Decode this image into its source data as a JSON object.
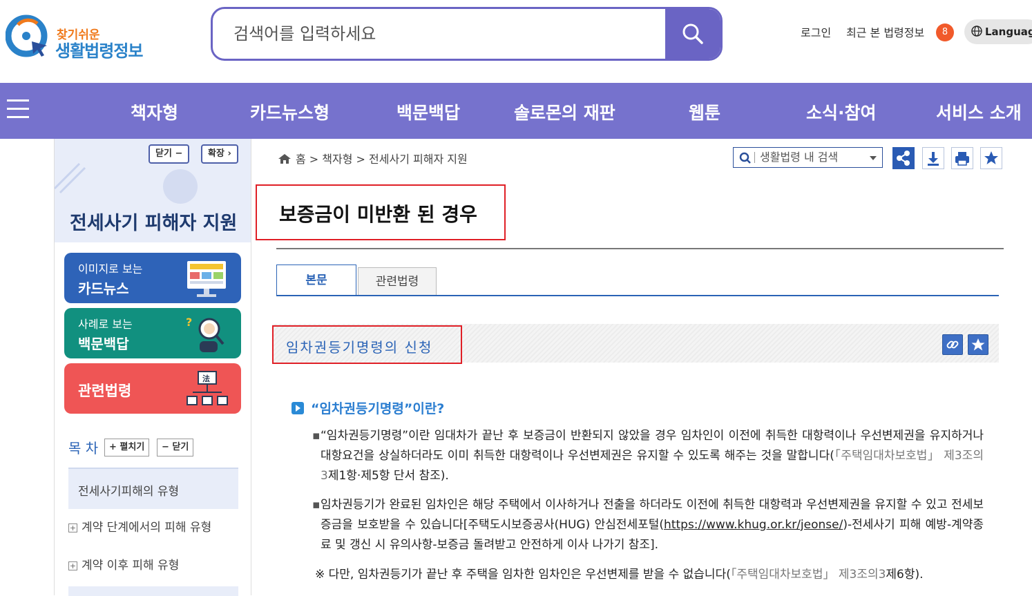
{
  "header": {
    "logo_small": "찾기쉬운",
    "logo_big": "생활법령정보",
    "search_placeholder": "검색어를 입력하세요",
    "login": "로그인",
    "recent": "최근 본 법령정보",
    "recent_count": "8",
    "language": "Language"
  },
  "nav": {
    "items": [
      "책자형",
      "카드뉴스형",
      "백문백답",
      "솔로몬의 재판",
      "웹툰",
      "소식·참여",
      "서비스 소개"
    ]
  },
  "sidebar": {
    "close_label": "닫기 −",
    "expand_label": "확장 ›",
    "title": "전세사기 피해자 지원",
    "cards": [
      {
        "small": "이미지로 보는",
        "big": "카드뉴스",
        "color": "#2e63b8"
      },
      {
        "small": "사례로 보는",
        "big": "백문백답",
        "color": "#11907f"
      },
      {
        "big": "관련법령",
        "color": "#ef5555"
      }
    ],
    "toc_label": "목 차",
    "toc_expand": "+ 펼치기",
    "toc_collapse": "− 닫기",
    "toc_selected": "전세사기피해의 유형",
    "toc_items": [
      "계약 단계에서의 피해 유형",
      "계약 이후 피해 유형"
    ]
  },
  "main": {
    "breadcrumb": "홈 > 책자형 > 전세사기 피해자 지원",
    "local_search": "생활법령 내 검색",
    "page_title": "보증금이 미반환 된 경우",
    "tabs": [
      "본문",
      "관련법령"
    ],
    "section_title": "임차권등기명령의 신청",
    "question_title": "“임차권등기명령”이란?",
    "para1_text": "“임차권등기명령”이란 임대차가 끝난 후 보증금이 반환되지 않았을 경우 임차인이 이전에 취득한 대항력이나 우선변제권을 유지하거나 대항요건을 상실하더라도 이미 취득한 대항력이나 우선변제권은 유지할 수 있도록 해주는 것을 말합니다(",
    "para1_ref": "「주택임대차보호법」 제3조의3",
    "para1_tail": "제1항·제5항 단서 참조).",
    "para2_text": "임차권등기가 완료된 임차인은 해당 주택에서 이사하거나 전출을 하더라도 이전에 취득한 대항력과 우선변제권을 유지할 수 있고 전세보증금을 보호받을 수 있습니다[주택도시보증공사(HUG) 안심전세포털(",
    "para2_link": "https://www.khug.or.kr/jeonse/",
    "para2_tail": ")-전세사기 피해 예방-계약종료 및 갱신 시 유의사항-보증금 돌려받고 안전하게 이사 나가기 참조].",
    "note_text": "※ 다만, 임차권등기가 끝난 후 주택을 임차한 임차인은 우선변제를 받을 수 없습니다(",
    "note_ref": "「주택임대차보호법」 제3조의3",
    "note_tail": "제6항)."
  }
}
